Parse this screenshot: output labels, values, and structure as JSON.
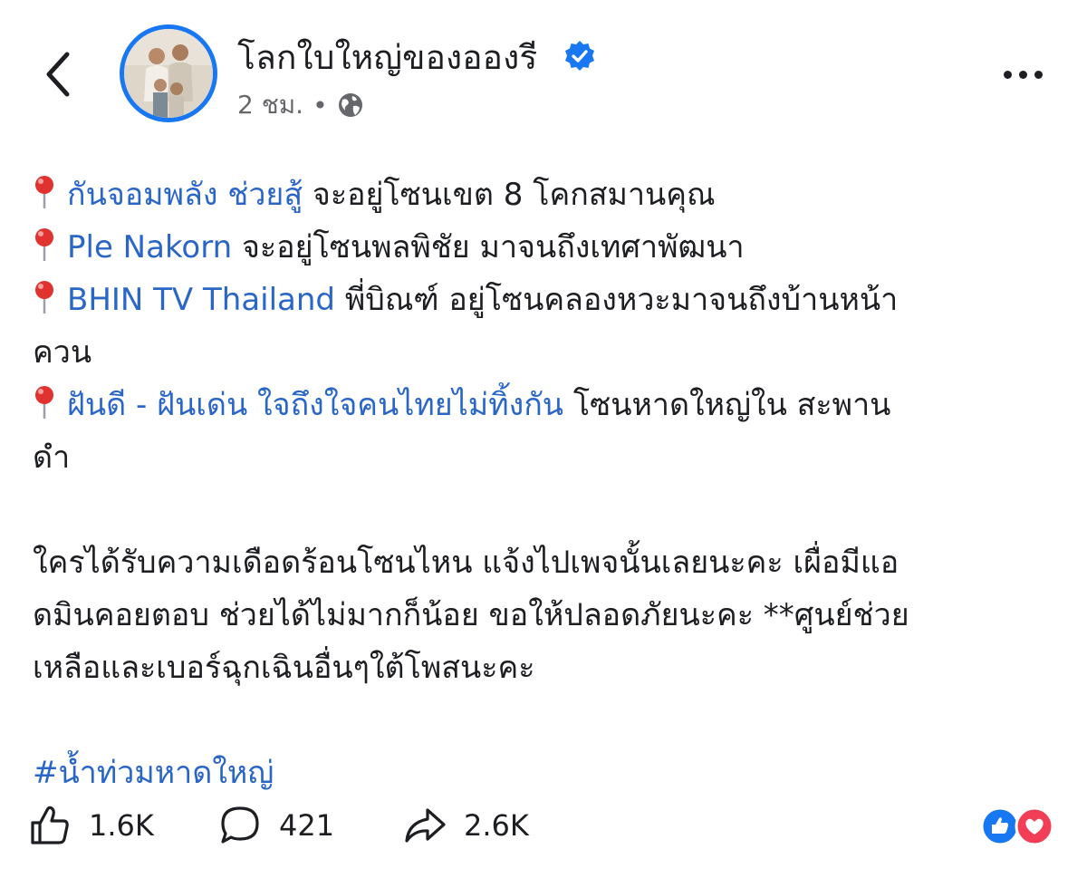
{
  "header": {
    "page_name": "โลกใบใหญ่ของอองรี",
    "time": "2 ชม.",
    "dot": "•"
  },
  "post": {
    "lines": [
      {
        "mention": "กันจอมพลัง ช่วยสู้",
        "text": " จะอยู่โซนเขต 8 โคกสมานคุณ"
      },
      {
        "mention": "Ple Nakorn",
        "text": " จะอยู่โซนพลพิชัย มาจนถึงเทศาพัฒนา"
      },
      {
        "mention": "BHIN TV Thailand",
        "text": " พี่บิณฑ์ อยู่โซนคลองหวะมาจนถึงบ้านหน้า",
        "wrap": "ควน"
      },
      {
        "mention": "ฝันดี - ฝันเด่น ใจถึงใจคนไทยไม่ทิ้งกัน",
        "text": " โซนหาดใหญ่ใน สะพาน",
        "wrap": "ดำ"
      }
    ],
    "paragraph": [
      "ใครได้รับความเดือดร้อนโซนไหน แจ้งไปเพจนั้นเลยนะคะ เผื่อมีแอ",
      "ดมินคอยตอบ ช่วยได้ไม่มากก็น้อย ขอให้ปลอดภัยนะคะ **ศูนย์ช่วย",
      "เหลือและเบอร์ฉุกเฉินอื่นๆใต้โพสนะคะ"
    ],
    "hashtag": "#น้ำท่วมหาดใหญ่"
  },
  "actions": {
    "likes": "1.6K",
    "comments": "421",
    "shares": "2.6K"
  },
  "colors": {
    "link": "#2a66c7",
    "brand_blue": "#1877f2",
    "secondary_text": "#65676b",
    "love_red": "#f33e58",
    "pin_red": "#e0322f"
  },
  "icons": {
    "back": "chevron-left-icon",
    "verified": "verified-badge-icon",
    "globe": "globe-icon",
    "more": "more-dots-icon",
    "pin": "pushpin-icon",
    "like": "thumbs-up-icon",
    "comment": "comment-bubble-icon",
    "share": "share-arrow-icon"
  }
}
